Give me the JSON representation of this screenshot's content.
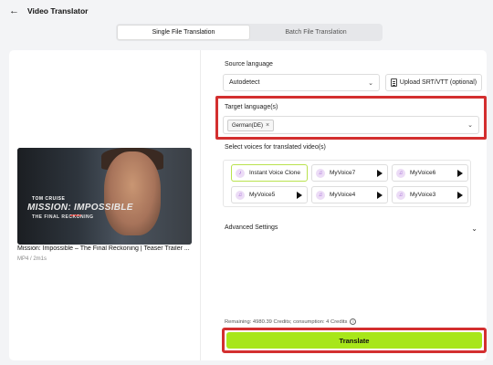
{
  "header": {
    "back_icon": "arrow-left-icon",
    "title": "Video Translator"
  },
  "tabs": [
    {
      "label": "Single File Translation",
      "active": true
    },
    {
      "label": "Batch File Translation",
      "active": false
    }
  ],
  "video": {
    "thumbnail_text": {
      "actor": "TOM CRUISE",
      "title_line1": "MISSION: IMPOSSIBLE",
      "title_line2": "THE FINAL RECKONING"
    },
    "title": "Mission: Impossible – The Final Reckoning | Teaser Trailer ...",
    "meta": "MP4 / 2m1s"
  },
  "source": {
    "label": "Source language",
    "value": "Autodetect",
    "upload_label": "Upload SRT/VTT (optional)"
  },
  "target": {
    "label": "Target language(s)",
    "selected": "German(DE)"
  },
  "voices": {
    "label": "Select voices for translated video(s)",
    "items": [
      {
        "label": "Instant Voice Clone",
        "selected": true
      },
      {
        "label": "MyVoice7"
      },
      {
        "label": "MyVoice6"
      },
      {
        "label": "MyVoice5"
      },
      {
        "label": "MyVoice4"
      },
      {
        "label": "MyVoice3"
      }
    ]
  },
  "advanced": {
    "label": "Advanced Settings"
  },
  "credits": {
    "text": "Remaining: 4980.39 Credits; consumption: 4 Credits"
  },
  "translate": {
    "label": "Translate"
  },
  "colors": {
    "accent": "#a8e61a",
    "highlight": "#d32f2f",
    "selected_voice_border": "#b9e24e"
  }
}
